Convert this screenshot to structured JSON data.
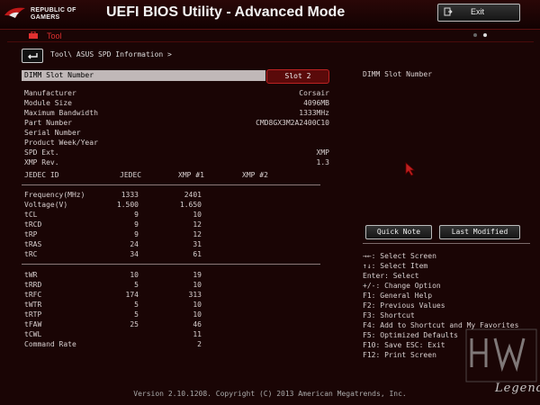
{
  "header": {
    "brand_line1": "REPUBLIC OF",
    "brand_line2": "GAMERS",
    "app_title": "UEFI BIOS Utility - Advanced Mode",
    "exit_label": "Exit"
  },
  "tab": {
    "label": "Tool"
  },
  "breadcrumb": "Tool\\ ASUS SPD Information >",
  "dimm": {
    "label": "DIMM Slot Number",
    "selected": "Slot 2"
  },
  "info": [
    {
      "key": "Manufacturer",
      "value": "Corsair"
    },
    {
      "key": "Module Size",
      "value": "4096MB"
    },
    {
      "key": "Maximum Bandwidth",
      "value": "1333MHz"
    },
    {
      "key": "Part Number",
      "value": "CMD8GX3M2A2400C10"
    },
    {
      "key": "Serial Number",
      "value": ""
    },
    {
      "key": "Product Week/Year",
      "value": ""
    },
    {
      "key": "SPD Ext.",
      "value": "XMP"
    },
    {
      "key": "XMP Rev.",
      "value": "1.3"
    }
  ],
  "table": {
    "headers": [
      "JEDEC ID",
      "JEDEC",
      "XMP #1",
      "XMP #2"
    ],
    "group1": [
      {
        "name": "Frequency(MHz)",
        "jedec": "1333",
        "xmp1": "2401"
      },
      {
        "name": "Voltage(V)",
        "jedec": "1.500",
        "xmp1": "1.650"
      },
      {
        "name": "tCL",
        "jedec": "9",
        "xmp1": "10"
      },
      {
        "name": "tRCD",
        "jedec": "9",
        "xmp1": "12"
      },
      {
        "name": "tRP",
        "jedec": "9",
        "xmp1": "12"
      },
      {
        "name": "tRAS",
        "jedec": "24",
        "xmp1": "31"
      },
      {
        "name": "tRC",
        "jedec": "34",
        "xmp1": "61"
      }
    ],
    "group2": [
      {
        "name": "tWR",
        "jedec": "10",
        "xmp1": "19"
      },
      {
        "name": "tRRD",
        "jedec": "5",
        "xmp1": "10"
      },
      {
        "name": "tRFC",
        "jedec": "174",
        "xmp1": "313"
      },
      {
        "name": "tWTR",
        "jedec": "5",
        "xmp1": "10"
      },
      {
        "name": "tRTP",
        "jedec": "5",
        "xmp1": "10"
      },
      {
        "name": "tFAW",
        "jedec": "25",
        "xmp1": "46"
      },
      {
        "name": "tCWL",
        "jedec": "",
        "xmp1": "11"
      },
      {
        "name": "Command Rate",
        "jedec": "",
        "xmp1": "2"
      }
    ]
  },
  "right_panel": {
    "title": "DIMM Slot Number",
    "quick_note": "Quick Note",
    "last_modified": "Last Modified",
    "help": [
      "→←: Select Screen",
      "↑↓: Select Item",
      "Enter: Select",
      "+/-: Change Option",
      "F1: General Help",
      "F2: Previous Values",
      "F3: Shortcut",
      "F4: Add to Shortcut and My Favorites",
      "F5: Optimized Defaults",
      "F10: Save  ESC: Exit",
      "F12: Print Screen"
    ]
  },
  "footer": "Version 2.10.1208. Copyright (C) 2013 American Megatrends, Inc.",
  "watermark": {
    "text": "Legend"
  },
  "colors": {
    "accent": "#e03030",
    "background": "#1a0505"
  }
}
